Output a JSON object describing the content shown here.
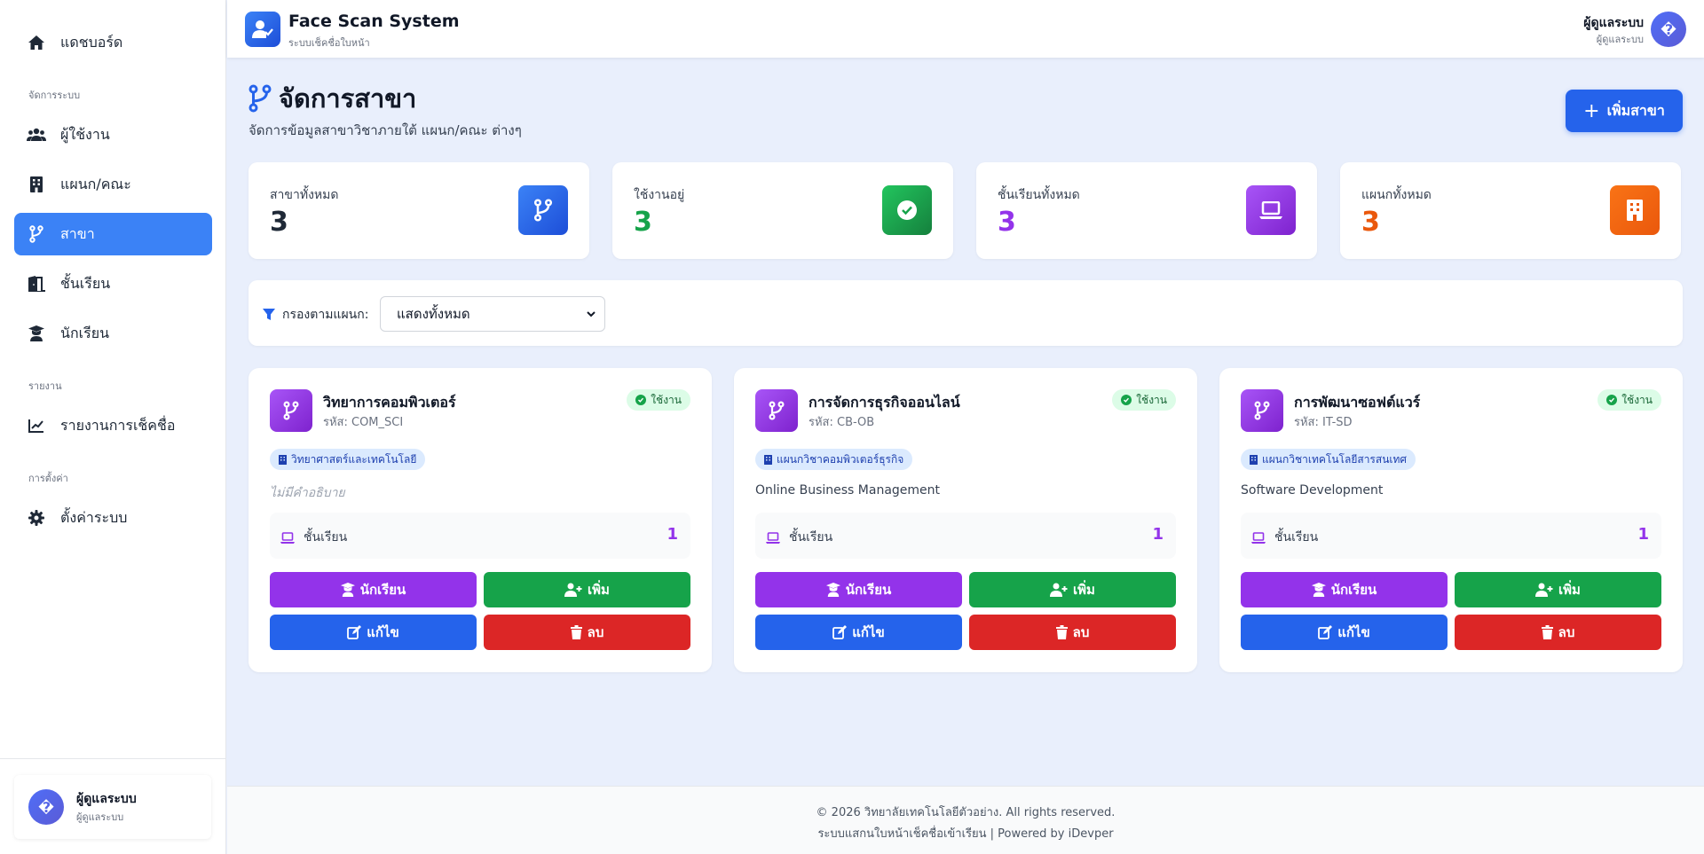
{
  "sidebar": {
    "items": [
      {
        "label": "แดชบอร์ด",
        "icon": "home-icon"
      },
      {
        "label": "ผู้ใช้งาน",
        "icon": "users-icon"
      },
      {
        "label": "แผนก/คณะ",
        "icon": "building-icon"
      },
      {
        "label": "สาขา",
        "icon": "code-branch-icon"
      },
      {
        "label": "ชั้นเรียน",
        "icon": "door-icon"
      },
      {
        "label": "นักเรียน",
        "icon": "graduate-icon"
      },
      {
        "label": "รายงานการเช็คชื่อ",
        "icon": "chart-line-icon"
      },
      {
        "label": "ตั้งค่าระบบ",
        "icon": "gear-icon"
      }
    ],
    "sections": [
      "จัดการระบบ",
      "รายงาน",
      "การตั้งค่า"
    ],
    "user": {
      "name": "ผู้ดูแลระบบ",
      "role": "ผู้ดูแลระบบ",
      "avatar": "�"
    }
  },
  "header": {
    "title": "Face Scan System",
    "subtitle": "ระบบเช็คชื่อใบหน้า",
    "user_name": "ผู้ดูแลระบบ",
    "user_role": "ผู้ดูแลระบบ",
    "avatar": "�"
  },
  "page": {
    "title": "จัดการสาขา",
    "subtitle": "จัดการข้อมูลสาขาวิชาภายใต้ แผนก/คณะ ต่างๆ",
    "add_button": "เพิ่มสาขา"
  },
  "stats": [
    {
      "label": "สาขาทั้งหมด",
      "value": "3",
      "color": "#1f2937",
      "icon": "code-branch-icon"
    },
    {
      "label": "ใช้งานอยู่",
      "value": "3",
      "color": "#16a34a",
      "icon": "check-circle-icon"
    },
    {
      "label": "ชั้นเรียนทั้งหมด",
      "value": "3",
      "color": "#9333ea",
      "icon": "laptop-icon"
    },
    {
      "label": "แผนกทั้งหมด",
      "value": "3",
      "color": "#ea580c",
      "icon": "building-icon"
    }
  ],
  "filter": {
    "label": "กรองตามแผนก:",
    "selected": "แสดงทั้งหมด"
  },
  "branches": [
    {
      "name": "วิทยาการคอมพิวเตอร์",
      "code": "รหัส: COM_SCI",
      "status": "ใช้งาน",
      "department": "วิทยาศาสตร์และเทคโนโลยี",
      "description": "ไม่มีคำอธิบาย",
      "class_label": "ชั้นเรียน",
      "class_count": "1"
    },
    {
      "name": "การจัดการธุรกิจออนไลน์",
      "code": "รหัส: CB-OB",
      "status": "ใช้งาน",
      "department": "แผนกวิชาคอมพิวเตอร์ธุรกิจ",
      "description": "Online Business Management",
      "class_label": "ชั้นเรียน",
      "class_count": "1"
    },
    {
      "name": "การพัฒนาซอฟต์แวร์",
      "code": "รหัส: IT-SD",
      "status": "ใช้งาน",
      "department": "แผนกวิชาเทคโนโลยีสารสนเทศ",
      "description": "Software Development",
      "class_label": "ชั้นเรียน",
      "class_count": "1"
    }
  ],
  "card_buttons": {
    "students": "นักเรียน",
    "add": "เพิ่ม",
    "edit": "แก้ไข",
    "delete": "ลบ"
  },
  "footer": {
    "line1": "© 2026 วิทยาลัยเทคโนโลยีตัวอย่าง. All rights reserved.",
    "line2": "ระบบแสกนใบหน้าเช็คชื่อเข้าเรียน | Powered by iDevper"
  },
  "colors": {
    "primary": "#2563eb",
    "active_nav": "#3b82f6",
    "purple": "#9333ea",
    "green": "#16a34a",
    "red": "#dc2626",
    "orange": "#ea580c"
  }
}
